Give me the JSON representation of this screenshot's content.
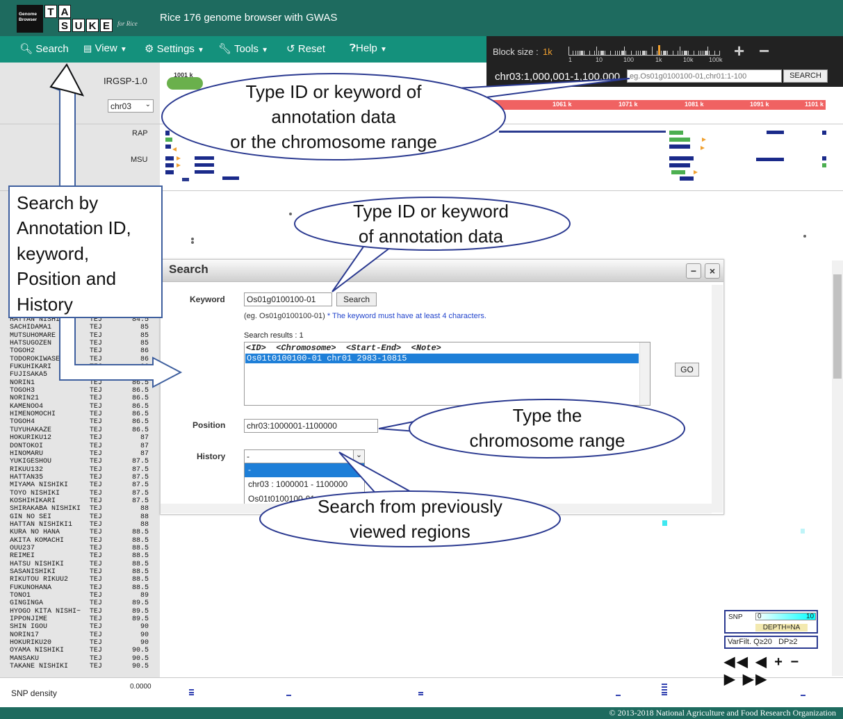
{
  "app": {
    "logo_line1": "Genome",
    "logo_line2": "Browser",
    "logo_letters": [
      "T",
      "A",
      "S",
      "U",
      "K",
      "E"
    ],
    "logo_for": "for Rice",
    "title": "Rice 176 genome browser with GWAS"
  },
  "menu": {
    "search": "Search",
    "view": "View",
    "settings": "Settings",
    "tools": "Tools",
    "reset": "Reset",
    "help": "Help"
  },
  "blocksize": {
    "label": "Block size :",
    "value": "1k",
    "scale_labels": [
      "1",
      "10",
      "100",
      "1k",
      "10k",
      "100k"
    ],
    "zoom_in": "+",
    "zoom_out": "−"
  },
  "region": {
    "current": "chr03:1,000,001-1,100,000",
    "placeholder": "eg.Os01g0100100-01,chr01:1-100",
    "search_button": "SEARCH"
  },
  "tracks": {
    "reference": "IRGSP-1.0",
    "chromosome": "chr03",
    "start_label": "1001 k",
    "ticks": [
      "1061 k",
      "1071 k",
      "1081 k",
      "1091 k",
      "1101 k"
    ],
    "rap": "RAP",
    "msu": "MSU"
  },
  "search_window": {
    "title": "Search",
    "minimize": "−",
    "close": "×",
    "keyword_label": "Keyword",
    "keyword_value": "Os01g0100100-01",
    "keyword_search": "Search",
    "hint_example": "(eg. Os01g0100100-01)",
    "hint_note": "* The keyword must have at least 4 characters.",
    "results_label": "Search results : 1",
    "results_header": "<ID>  <Chromosome>  <Start-End>  <Note>",
    "results": [
      "Os01t0100100-01 chr01 2983-10815"
    ],
    "go": "GO",
    "position_label": "Position",
    "position_value": "chr03:1000001-1100000",
    "history_label": "History",
    "history_value": "-",
    "history_options": [
      "-",
      "chr03 : 1000001 - 1100000",
      "Os01t0100100-01"
    ]
  },
  "annotations": {
    "left_box": [
      "Search by",
      "Annotation ID,",
      "keyword,",
      "Position and",
      "History"
    ],
    "bubble_top": [
      "Type ID or keyword of",
      "annotation data",
      "or the chromosome range"
    ],
    "bubble_keyword": [
      "Type ID or keyword",
      "of annotation data"
    ],
    "bubble_position": [
      "Type the",
      "chromosome range"
    ],
    "bubble_history": [
      "Search from previously",
      "viewed regions"
    ]
  },
  "samples": [
    [
      "HATTAN NISHIKI2",
      "TEJ",
      "84.5"
    ],
    [
      "SACHIDAMA1",
      "TEJ",
      "85"
    ],
    [
      "MUTSUHOMARE",
      "TEJ",
      "85"
    ],
    [
      "HATSUGOZEN",
      "TEJ",
      "85"
    ],
    [
      "TOGOH2",
      "TEJ",
      "86"
    ],
    [
      "TODOROKIWASE",
      "TEJ",
      "86"
    ],
    [
      "FUKUHIKARI",
      "TEJ",
      "86"
    ],
    [
      "FUJISAKA5",
      "TEJ",
      "86"
    ],
    [
      "NORIN1",
      "TEJ",
      "86.5"
    ],
    [
      "TOGOH3",
      "TEJ",
      "86.5"
    ],
    [
      "NORIN21",
      "TEJ",
      "86.5"
    ],
    [
      "KAMENOO4",
      "TEJ",
      "86.5"
    ],
    [
      "HIMENOMOCHI",
      "TEJ",
      "86.5"
    ],
    [
      "TOGOH4",
      "TEJ",
      "86.5"
    ],
    [
      "TUYUHAKAZE",
      "TEJ",
      "86.5"
    ],
    [
      "HOKURIKU12",
      "TEJ",
      "87"
    ],
    [
      "DONTOKOI",
      "TEJ",
      "87"
    ],
    [
      "HINOMARU",
      "TEJ",
      "87"
    ],
    [
      "YUKIGESHOU",
      "TEJ",
      "87.5"
    ],
    [
      "RIKUU132",
      "TEJ",
      "87.5"
    ],
    [
      "HATTAN35",
      "TEJ",
      "87.5"
    ],
    [
      "MIYAMA NISHIKI",
      "TEJ",
      "87.5"
    ],
    [
      "TOYO NISHIKI",
      "TEJ",
      "87.5"
    ],
    [
      "KOSHIHIKARI",
      "TEJ",
      "87.5"
    ],
    [
      "SHIRAKABA NISHIKI",
      "TEJ",
      "88"
    ],
    [
      "GIN NO SEI",
      "TEJ",
      "88"
    ],
    [
      "HATTAN NISHIKI1",
      "TEJ",
      "88"
    ],
    [
      "KURA NO HANA",
      "TEJ",
      "88.5"
    ],
    [
      "AKITA KOMACHI",
      "TEJ",
      "88.5"
    ],
    [
      "OUU237",
      "TEJ",
      "88.5"
    ],
    [
      "REIMEI",
      "TEJ",
      "88.5"
    ],
    [
      "HATSU NISHIKI",
      "TEJ",
      "88.5"
    ],
    [
      "SASANISHIKI",
      "TEJ",
      "88.5"
    ],
    [
      "RIKUTOU RIKUU2",
      "TEJ",
      "88.5"
    ],
    [
      "FUKUNOHANA",
      "TEJ",
      "88.5"
    ],
    [
      "TONO1",
      "TEJ",
      "89"
    ],
    [
      "GINGINGA",
      "TEJ",
      "89.5"
    ],
    [
      "HYOGO KITA NISHI~",
      "TEJ",
      "89.5"
    ],
    [
      "IPPONJIME",
      "TEJ",
      "89.5"
    ],
    [
      "SHIN IGOU",
      "TEJ",
      "90"
    ],
    [
      "NORIN17",
      "TEJ",
      "90"
    ],
    [
      "HOKURIKU20",
      "TEJ",
      "90"
    ],
    [
      "OYAMA NISHIKI",
      "TEJ",
      "90.5"
    ],
    [
      "MANSAKU",
      "TEJ",
      "90.5"
    ],
    [
      "TAKANE NISHIKI",
      "TEJ",
      "90.5"
    ]
  ],
  "legend": {
    "snp": "SNP",
    "min": "0",
    "max": "10",
    "depth": "DEPTH=NA",
    "varfilt": "VarFilt.",
    "q": "Q≥20",
    "dp": "DP≥2",
    "nav": "◀◀ ◀ + − ▶ ▶▶"
  },
  "bottom": {
    "snp_density": "SNP density",
    "snp_density_value": "0.0000",
    "copyright": "© 2013-2018 National Agriculture and Food Research Organization"
  },
  "colors": {
    "header": "#1e6b5f",
    "menubar": "#14917c",
    "accent": "#f0a030",
    "bubble_border": "#2a3990",
    "selected": "#1e7fd8"
  }
}
